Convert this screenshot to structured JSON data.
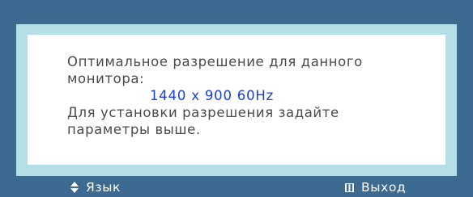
{
  "dialog": {
    "line1": "Оптимальное разрешение для данного",
    "line2": "монитора:",
    "resolution": "1440 x 900 60Hz",
    "line3": "Для установки разрешения задайте",
    "line4": "параметры выше."
  },
  "footer": {
    "language_label": "Язык",
    "language_icon": "up-down-arrows-icon",
    "exit_label": "Выход",
    "exit_icon": "menu-icon"
  },
  "colors": {
    "background": "#3d6a91",
    "frame": "#b4dfe6",
    "panel": "#ffffff",
    "text": "#4a4a4a",
    "resolution": "#1a3fd6"
  }
}
